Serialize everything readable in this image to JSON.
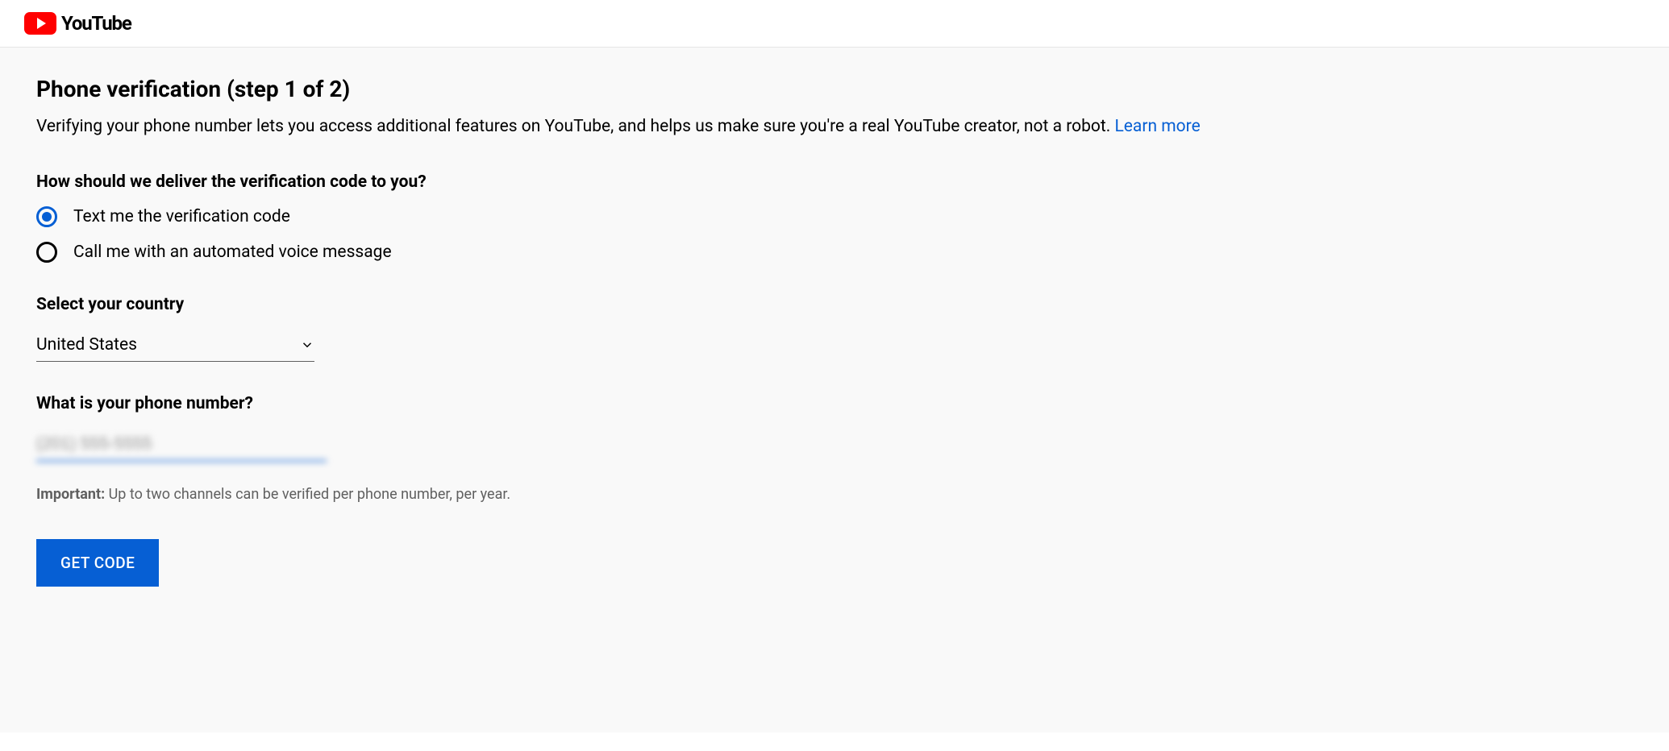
{
  "header": {
    "brand_text": "YouTube"
  },
  "page": {
    "title": "Phone verification (step 1 of 2)",
    "description": "Verifying your phone number lets you access additional features on YouTube, and helps us make sure you're a real YouTube creator, not a robot. ",
    "learn_more": "Learn more"
  },
  "delivery": {
    "label": "How should we deliver the verification code to you?",
    "options": [
      {
        "label": "Text me the verification code",
        "selected": true
      },
      {
        "label": "Call me with an automated voice message",
        "selected": false
      }
    ]
  },
  "country": {
    "label": "Select your country",
    "value": "United States"
  },
  "phone": {
    "label": "What is your phone number?",
    "placeholder": "(201) 555-5555"
  },
  "note": {
    "bold": "Important:",
    "text": " Up to two channels can be verified per phone number, per year."
  },
  "button": {
    "get_code": "GET CODE"
  }
}
